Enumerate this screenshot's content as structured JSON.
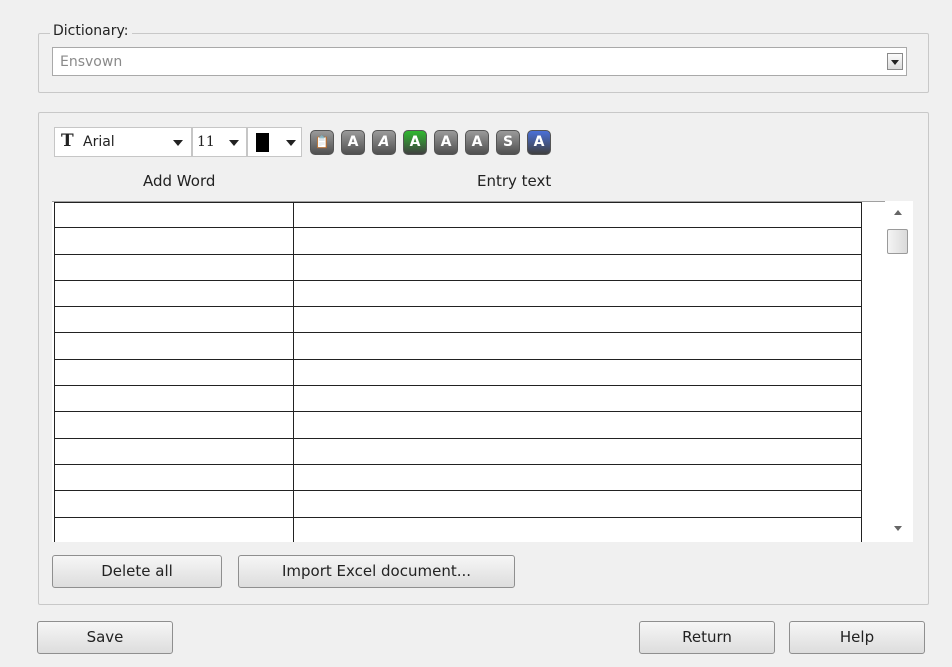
{
  "dictionary": {
    "label": "Dictionary:",
    "selected": "Ensvown"
  },
  "toolbar": {
    "font_name": "Arial",
    "font_size": "11",
    "text_color": "#000000",
    "format_buttons": [
      {
        "icon": "paste-icon",
        "glyph": "📋",
        "color": "#6e6e6e"
      },
      {
        "icon": "bold-icon",
        "glyph": "A",
        "color": "#6e6e6e"
      },
      {
        "icon": "italic-icon",
        "glyph": "A",
        "color": "#6e6e6e"
      },
      {
        "icon": "underline-icon",
        "glyph": "A",
        "color": "#2fb82f"
      },
      {
        "icon": "superscript-icon",
        "glyph": "A",
        "color": "#6e6e6e"
      },
      {
        "icon": "subscript-icon",
        "glyph": "A",
        "color": "#6e6e6e"
      },
      {
        "icon": "strikethrough-icon",
        "glyph": "S",
        "color": "#6e6e6e"
      },
      {
        "icon": "highlight-icon",
        "glyph": "A",
        "color": "#4a6fd8"
      }
    ]
  },
  "table": {
    "headers": [
      "Add Word",
      "Entry text"
    ],
    "rows": [
      [
        "",
        ""
      ],
      [
        "",
        ""
      ],
      [
        "",
        ""
      ],
      [
        "",
        ""
      ],
      [
        "",
        ""
      ],
      [
        "",
        ""
      ],
      [
        "",
        ""
      ],
      [
        "",
        ""
      ],
      [
        "",
        ""
      ],
      [
        "",
        ""
      ],
      [
        "",
        ""
      ],
      [
        "",
        ""
      ],
      [
        "",
        ""
      ]
    ]
  },
  "buttons": {
    "delete_all": "Delete all",
    "import_excel": "Import Excel document...",
    "save": "Save",
    "return": "Return",
    "help": "Help"
  }
}
